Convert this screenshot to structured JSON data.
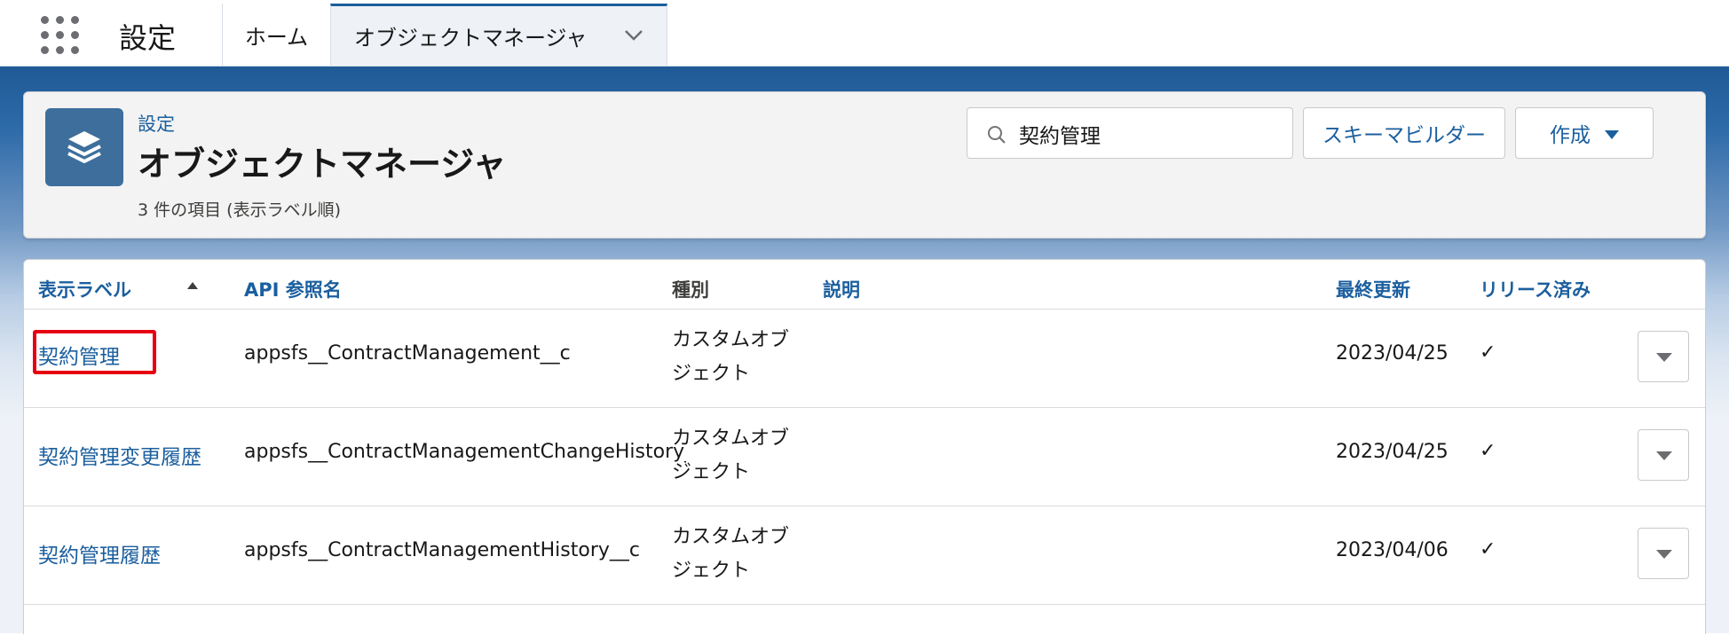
{
  "nav": {
    "app_name": "設定",
    "tabs": [
      {
        "label": "ホーム"
      },
      {
        "label": "オブジェクトマネージャ"
      }
    ],
    "icons": {
      "launcher": "waffle-grid-icon",
      "tab_menu": "chevron-down-icon"
    }
  },
  "header": {
    "breadcrumb": "設定",
    "title": "オブジェクトマネージャ",
    "subtitle": "3 件の項目 (表示ラベル順)",
    "search_value": "契約管理",
    "schema_builder_label": "スキーマビルダー",
    "create_label": "作成",
    "icon": "layers-icon"
  },
  "table": {
    "columns": {
      "label": "表示ラベル",
      "api": "API 参照名",
      "type": "種別",
      "description": "説明",
      "modified": "最終更新",
      "deployed": "リリース済み"
    },
    "rows": [
      {
        "label": "契約管理",
        "api": "appsfs__ContractManagement__c",
        "type": "カスタムオブジェクト",
        "description": "",
        "modified": "2023/04/25",
        "deployed": "✓"
      },
      {
        "label": "契約管理変更履歴",
        "api": "appsfs__ContractManagementChangeHistory__c",
        "type": "カスタムオブジェクト",
        "description": "",
        "modified": "2023/04/25",
        "deployed": "✓"
      },
      {
        "label": "契約管理履歴",
        "api": "appsfs__ContractManagementHistory__c",
        "type": "カスタムオブジェクト",
        "description": "",
        "modified": "2023/04/06",
        "deployed": "✓"
      }
    ]
  },
  "colors": {
    "link": "#1b5f9e",
    "brand_band": "#1f5a96",
    "highlight": "#e60012"
  }
}
